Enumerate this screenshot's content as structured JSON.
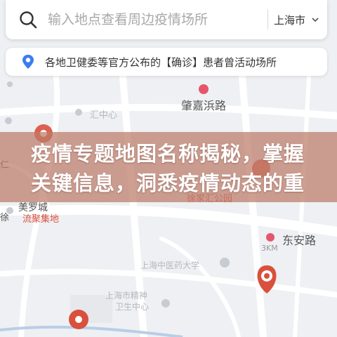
{
  "search": {
    "placeholder": "输入地点查看周边疫情场所",
    "city": "上海市",
    "icon": "search-icon",
    "dropdown_icon": "chevron-down-icon"
  },
  "notice": {
    "icon": "location-pin-icon",
    "text": "各地卫健委等官方公布的【确诊】患者曾活动场所",
    "accent_color": "#3b7df0"
  },
  "banner": {
    "line1": "疫情专题地图名称揭秘，掌握",
    "line2": "关键信息，洞悉疫情动态的重"
  },
  "map": {
    "labels": {
      "zhaojiabang_road": "肇嘉浜路",
      "dongan_road": "东安路",
      "meiluo_city": "美罗城",
      "liuju_jidi": "流聚集地",
      "distance": "3KM",
      "xujiahui_park": "徐家汇公园",
      "west_fragment": "汇",
      "west_fragment_2": "徐",
      "left_edge": "仁",
      "mid_faded": "汇中心",
      "south_faded_1": "上海中医药大学",
      "south_faded_2": "上海市精神",
      "south_faded_3": "卫生中心"
    },
    "colors": {
      "road": "#ffffff",
      "water": "#b9cde6",
      "metro_pin": "#e5566d",
      "hotspot": "#d9503d"
    }
  }
}
